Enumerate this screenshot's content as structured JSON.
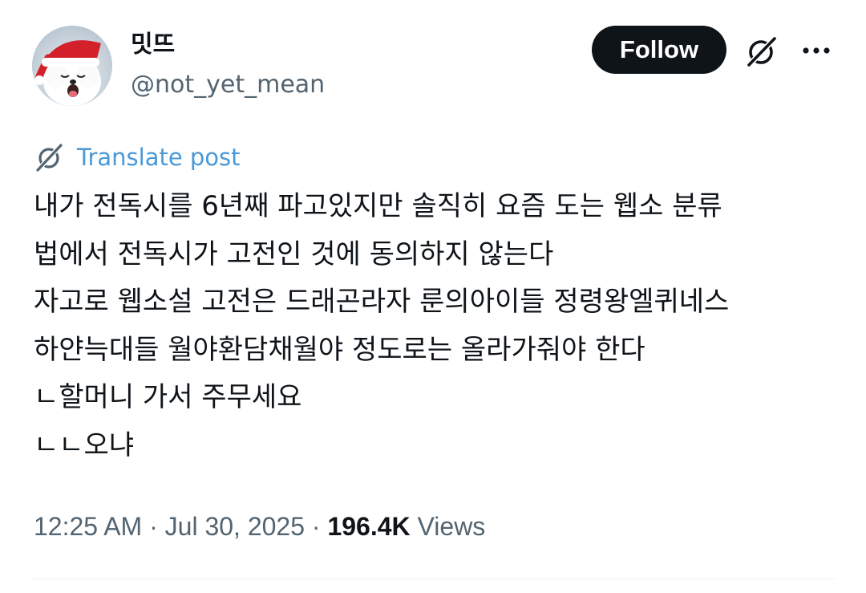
{
  "author": {
    "display_name": "밋뜨",
    "handle": "@not_yet_mean"
  },
  "actions": {
    "follow_label": "Follow"
  },
  "translate": {
    "label": "Translate post"
  },
  "post": {
    "lines": [
      "내가 전독시를 6년째 파고있지만 솔직히 요즘 도는 웹소 분류",
      "법에서 전독시가 고전인 것에 동의하지 않는다",
      "자고로 웹소설 고전은 드래곤라자 룬의아이들 정령왕엘퀴네스",
      "하얀늑대들 월야환담채월야 정도로는 올라가줘야 한다",
      "ㄴ할머니 가서 주무세요",
      "ㄴㄴ오냐"
    ]
  },
  "meta": {
    "time": "12:25 AM",
    "date": "Jul 30, 2025",
    "separator": "·",
    "views_count": "196.4K",
    "views_label": "Views"
  },
  "icons": {
    "grok": "grok-icon",
    "more": "more-dots-icon",
    "translate": "translate-icon",
    "avatar": "santa-hat-dog-avatar"
  },
  "colors": {
    "text": "#0f1419",
    "secondary": "#536471",
    "link": "#4a98d6",
    "follow_bg": "#0f1419",
    "follow_text": "#ffffff",
    "divider": "#eff3f4"
  }
}
